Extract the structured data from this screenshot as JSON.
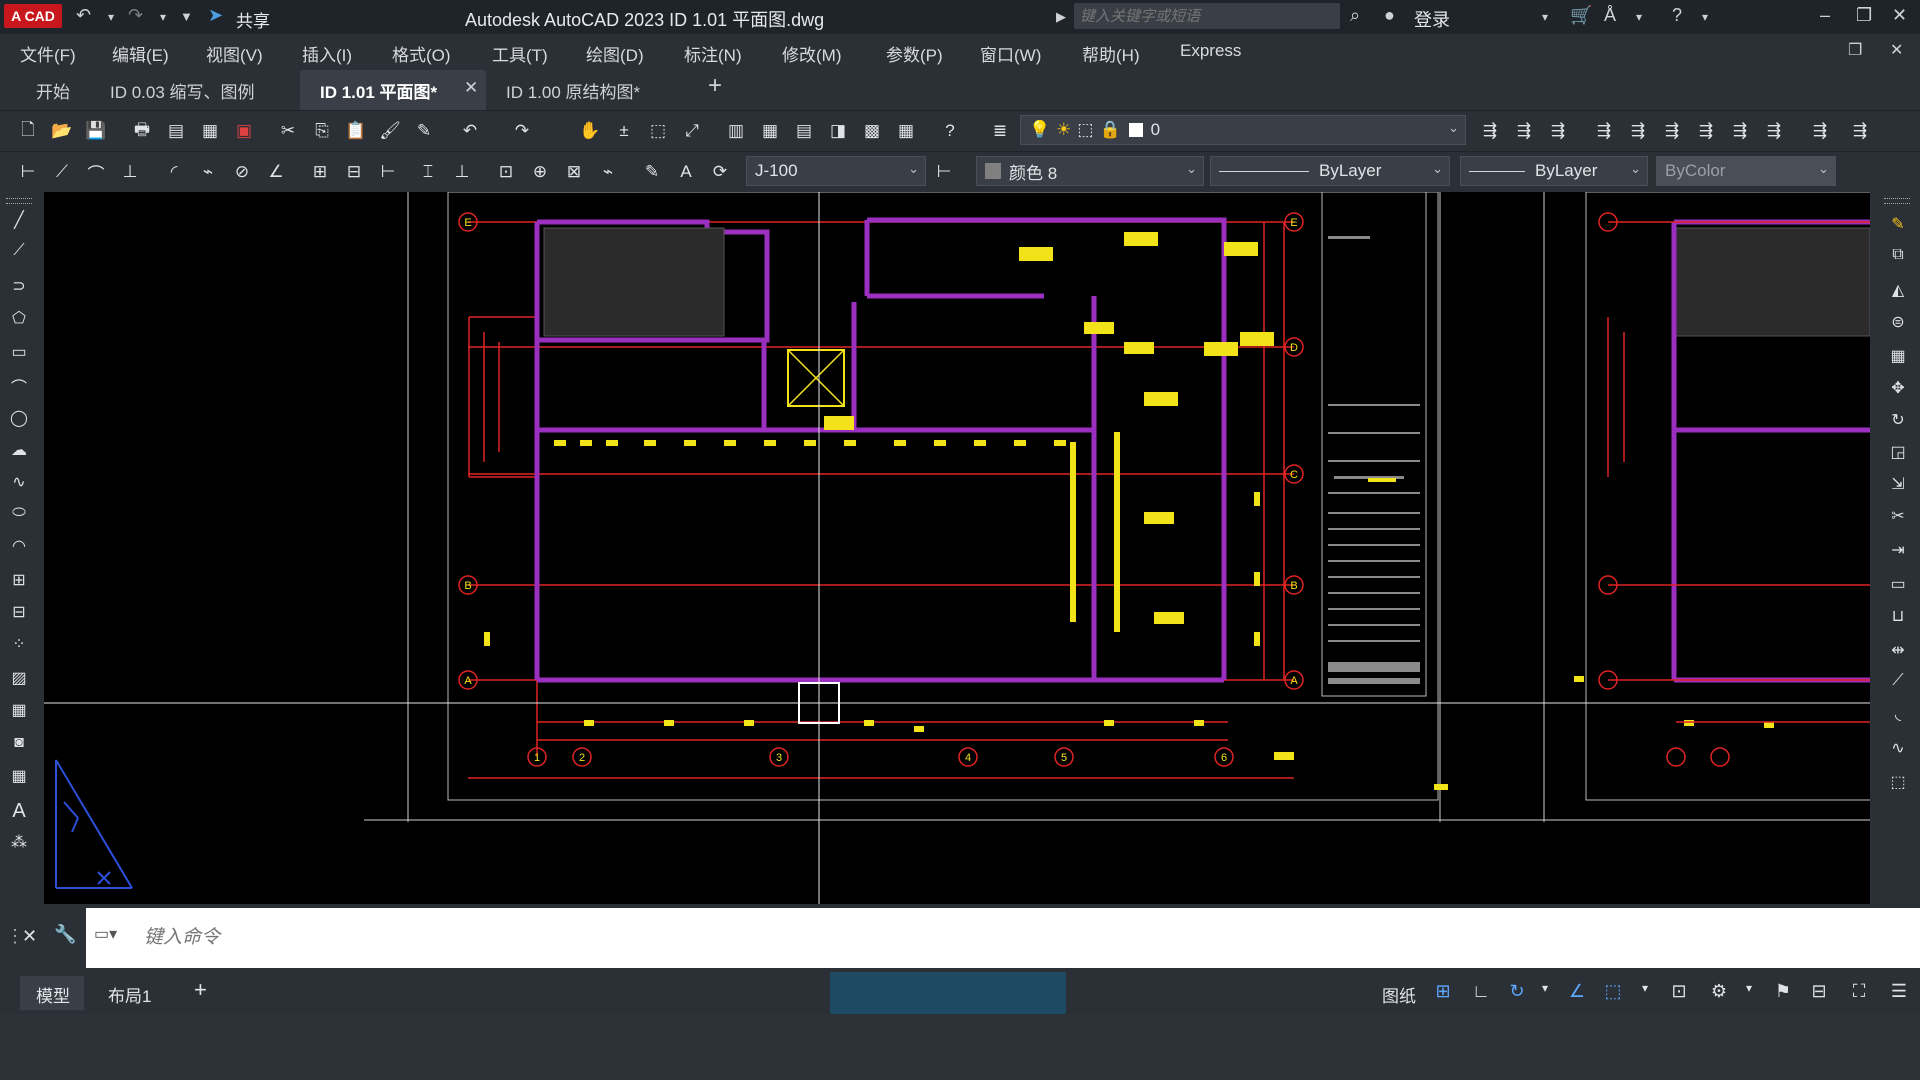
{
  "app": {
    "logo": "A CAD",
    "share_label": "共享",
    "title": "Autodesk AutoCAD 2023     ID 1.01 平面图.dwg",
    "search_placeholder": "键入关键字或短语",
    "login_label": "登录"
  },
  "menu": {
    "items": [
      "文件(F)",
      "编辑(E)",
      "视图(V)",
      "插入(I)",
      "格式(O)",
      "工具(T)",
      "绘图(D)",
      "标注(N)",
      "修改(M)",
      "参数(P)",
      "窗口(W)",
      "帮助(H)",
      "Express"
    ]
  },
  "tabs": {
    "start": "开始",
    "items": [
      {
        "label": "ID 0.03 缩写、图例"
      },
      {
        "label": "ID 1.01 平面图*"
      },
      {
        "label": "ID 1.00 原结构图*"
      }
    ]
  },
  "toolbar": {
    "layer_value": "0",
    "dimstyle_value": "J-100",
    "color_value": "颜色 8",
    "linetype_value": "ByLayer",
    "lineweight_value": "ByLayer",
    "plotstyle_value": "ByColor"
  },
  "drawing": {
    "grid_labels_left": [
      "E",
      "D",
      "C",
      "B",
      "A"
    ],
    "column_numbers": [
      "1",
      "2",
      "3",
      "4",
      "5",
      "6"
    ]
  },
  "command": {
    "placeholder": "键入命令"
  },
  "status": {
    "model_tab": "模型",
    "layout_tab": "布局1",
    "paper_label": "图纸"
  },
  "colors": {
    "wall": "#9b2fbf",
    "red_line": "#e02424",
    "yellow": "#f2e21a",
    "accent_blue": "#2d6fd8"
  }
}
